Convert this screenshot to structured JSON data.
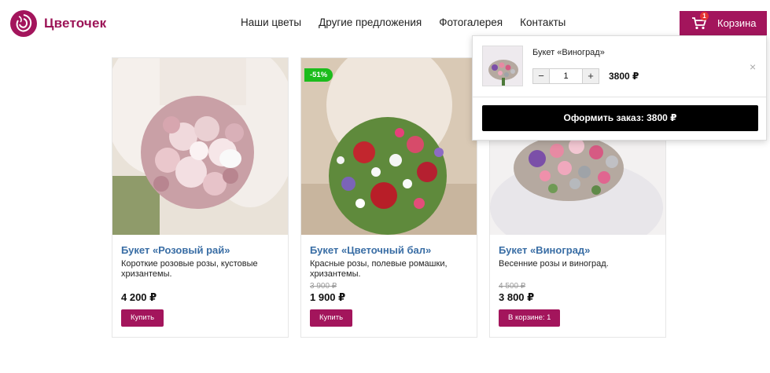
{
  "brand": {
    "name": "Цветочек",
    "color": "#9c1457"
  },
  "nav": [
    "Наши цветы",
    "Другие предложения",
    "Фотогалерея",
    "Контакты"
  ],
  "cart_button": {
    "label": "Корзина",
    "count": "1",
    "icon": "shopping-cart-icon"
  },
  "colors": {
    "accent": "#a3155c",
    "link": "#3a6ea5",
    "discount": "#1cbc1c"
  },
  "products": [
    {
      "title": "Букет «Розовый рай»",
      "desc": "Короткие розовые розы, кустовые хризантемы.",
      "old_price": "",
      "price": "4 200 ₽",
      "button": "Купить",
      "discount": ""
    },
    {
      "title": "Букет «Цветочный бал»",
      "desc": "Красные розы, полевые ромашки, хризантемы.",
      "old_price": "3 900 ₽",
      "price": "1 900 ₽",
      "button": "Купить",
      "discount": "-51%"
    },
    {
      "title": "Букет «Виноград»",
      "desc": "Весенние розы и виноград.",
      "old_price": "4 500 ₽",
      "price": "3 800 ₽",
      "button": "В корзине: 1",
      "discount": ""
    }
  ],
  "cart_popup": {
    "item_name": "Букет «Виноград»",
    "qty": "1",
    "minus": "−",
    "plus": "+",
    "price": "3800 ₽",
    "close": "×",
    "checkout": "Оформить заказ: 3800 ₽"
  }
}
